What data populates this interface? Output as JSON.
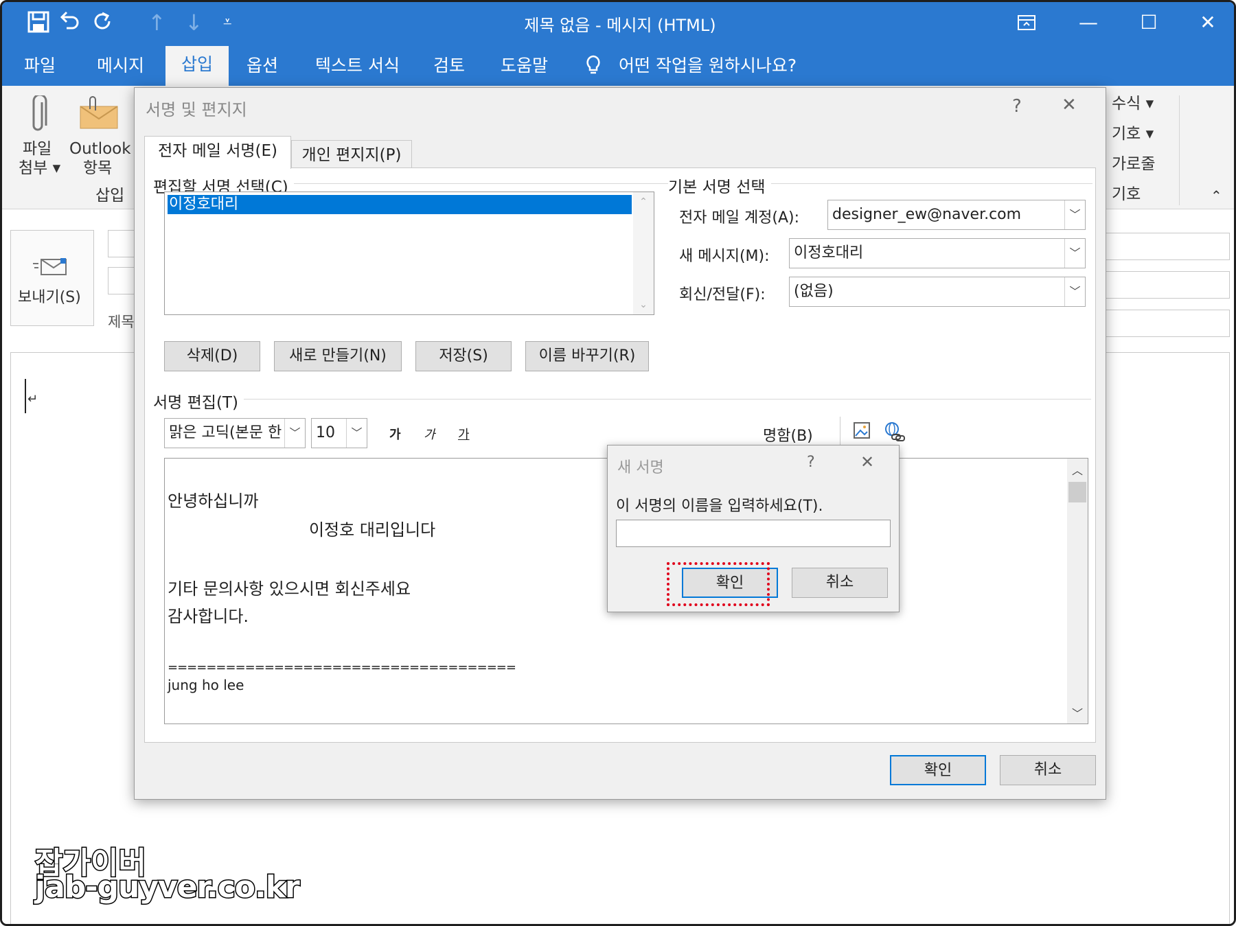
{
  "window": {
    "title": "제목 없음  -  메시지 (HTML)",
    "accent": "#2b79d0",
    "quick_access": [
      "save-icon",
      "undo-icon",
      "redo-icon",
      "up-icon",
      "down-icon",
      "customize-icon"
    ]
  },
  "menu": {
    "items": [
      "파일",
      "메시지",
      "삽입",
      "옵션",
      "텍스트 서식",
      "검토",
      "도움말"
    ],
    "tell_me": "어떤 작업을 원하시나요?"
  },
  "ribbon": {
    "attach_file": [
      "파일",
      "첨부 ▾"
    ],
    "outlook_item": [
      "Outlook",
      "항목"
    ],
    "group_insert": "삽입",
    "right_items": [
      "수식  ▾",
      "기호 ▾",
      "가로줄",
      "기호"
    ]
  },
  "compose": {
    "send_label": "보내기(S)",
    "subject_label": "제목"
  },
  "dialog": {
    "title": "서명 및 편지지",
    "help": "?",
    "close": "✕",
    "tabs": [
      "전자 메일 서명(E)",
      "개인 편지지(P)"
    ],
    "edit_select_label": "편집할 서명 선택(C)",
    "signatures": [
      "이정호대리"
    ],
    "buttons": {
      "delete": "삭제(D)",
      "new": "새로 만들기(N)",
      "save": "저장(S)",
      "rename": "이름 바꾸기(R)"
    },
    "default_label": "기본 서명 선택",
    "email_account_label": "전자 메일 계정(A):",
    "email_account_value": "designer_ew@naver.com",
    "new_message_label": "새 메시지(M):",
    "new_message_value": "이정호대리",
    "reply_label": "회신/전달(F):",
    "reply_value": "(없음)",
    "edit_label": "서명 편집(T)",
    "font_value": "맑은 고딕(본문 한",
    "size_value": "10",
    "format_buttons": [
      "가",
      "가",
      "가"
    ],
    "business_card": "명함(B)",
    "body_lines": [
      "안녕하십니까",
      "                           이정호 대리입니다",
      "기타 문의사항 있으시면 회신주세요",
      "감사합니다.",
      "====================================",
      "jung ho lee"
    ],
    "ok": "확인",
    "cancel": "취소"
  },
  "new_signature": {
    "title": "새 서명",
    "help": "?",
    "close": "✕",
    "prompt": "이 서명의 이름을 입력하세요(T).",
    "input_value": "",
    "ok": "확인",
    "cancel": "취소"
  },
  "watermark": {
    "line1": "잡가이버",
    "line2": "jab-guyver.co.kr"
  }
}
